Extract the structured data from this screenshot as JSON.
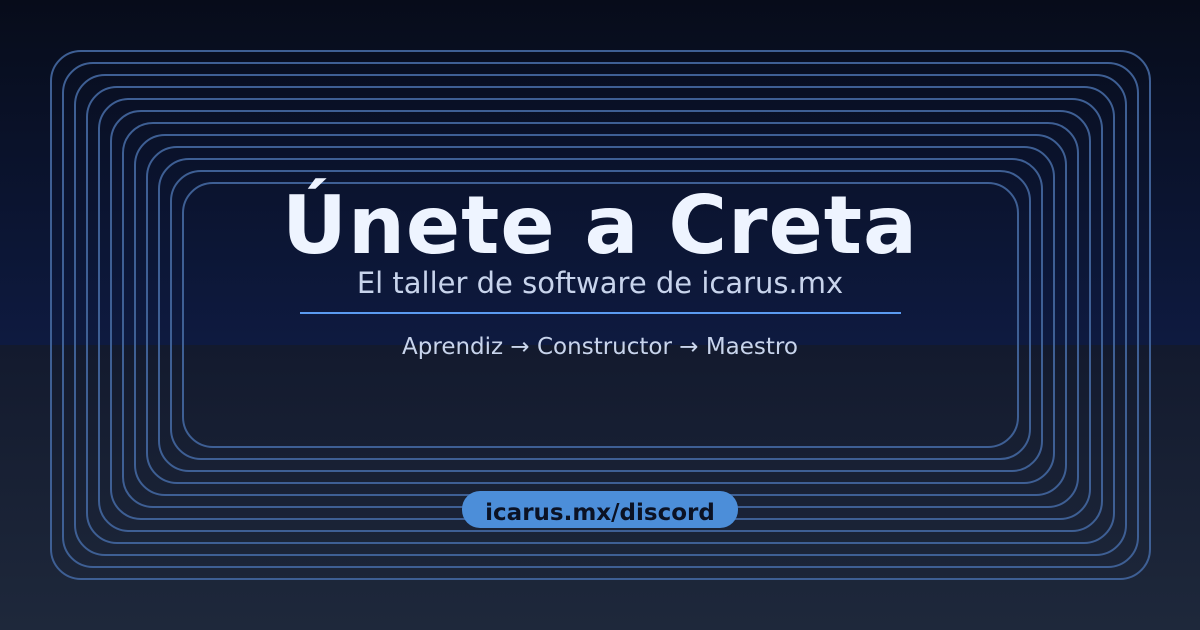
{
  "heading": "Únete a Creta",
  "subheading": "El taller de software de icarus.mx",
  "progression": "Aprendiz → Constructor → Maestro",
  "cta_link": "icarus.mx/discord",
  "colors": {
    "background_top": "#070c1a",
    "background_mid": "#0e1a40",
    "background_bottom": "#1e283b",
    "frame_stroke": "#3e5f94",
    "accent": "#5b9bf0",
    "pill": "#4c8ed9",
    "title_text": "#eef4ff",
    "body_text": "#c8d4ec"
  }
}
